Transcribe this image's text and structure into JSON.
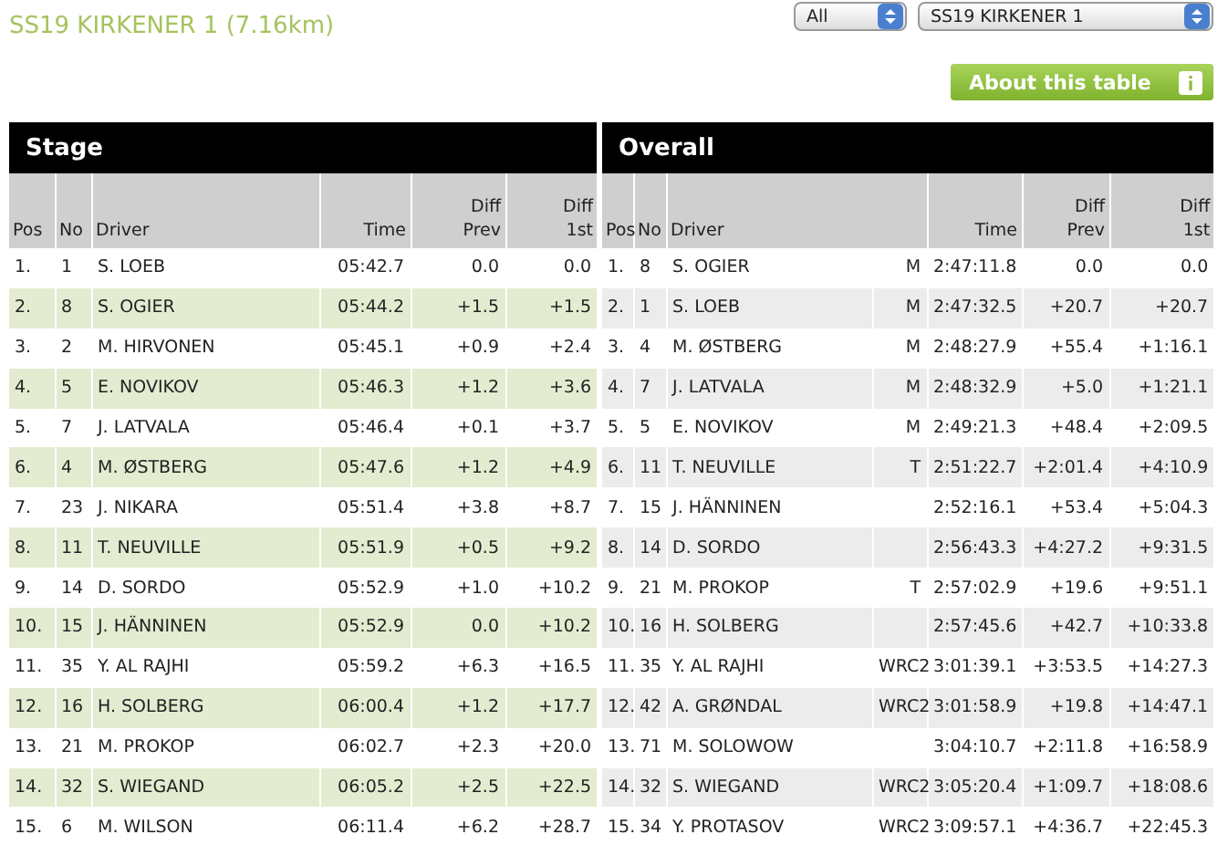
{
  "title": "SS19 KIRKENER 1 (7.16km)",
  "filters": [
    {
      "value": "All"
    },
    {
      "value": "SS19 KIRKENER 1"
    }
  ],
  "about_button": {
    "label": "About this table"
  },
  "stage": {
    "title": "Stage",
    "columns": [
      "Pos",
      "No",
      "Driver",
      "Time",
      "Diff Prev",
      "Diff 1st"
    ],
    "rows": [
      [
        "1.",
        "1",
        "S. LOEB",
        "05:42.7",
        "0.0",
        "0.0"
      ],
      [
        "2.",
        "8",
        "S. OGIER",
        "05:44.2",
        "+1.5",
        "+1.5"
      ],
      [
        "3.",
        "2",
        "M. HIRVONEN",
        "05:45.1",
        "+0.9",
        "+2.4"
      ],
      [
        "4.",
        "5",
        "E. NOVIKOV",
        "05:46.3",
        "+1.2",
        "+3.6"
      ],
      [
        "5.",
        "7",
        "J. LATVALA",
        "05:46.4",
        "+0.1",
        "+3.7"
      ],
      [
        "6.",
        "4",
        "M. ØSTBERG",
        "05:47.6",
        "+1.2",
        "+4.9"
      ],
      [
        "7.",
        "23",
        "J. NIKARA",
        "05:51.4",
        "+3.8",
        "+8.7"
      ],
      [
        "8.",
        "11",
        "T. NEUVILLE",
        "05:51.9",
        "+0.5",
        "+9.2"
      ],
      [
        "9.",
        "14",
        "D. SORDO",
        "05:52.9",
        "+1.0",
        "+10.2"
      ],
      [
        "10.",
        "15",
        "J. HÄNNINEN",
        "05:52.9",
        "0.0",
        "+10.2"
      ],
      [
        "11.",
        "35",
        "Y. AL RAJHI",
        "05:59.2",
        "+6.3",
        "+16.5"
      ],
      [
        "12.",
        "16",
        "H. SOLBERG",
        "06:00.4",
        "+1.2",
        "+17.7"
      ],
      [
        "13.",
        "21",
        "M. PROKOP",
        "06:02.7",
        "+2.3",
        "+20.0"
      ],
      [
        "14.",
        "32",
        "S. WIEGAND",
        "06:05.2",
        "+2.5",
        "+22.5"
      ],
      [
        "15.",
        "6",
        "M. WILSON",
        "06:11.4",
        "+6.2",
        "+28.7"
      ]
    ]
  },
  "overall": {
    "title": "Overall",
    "columns": [
      "Pos",
      "No",
      "Driver",
      "",
      "Time",
      "Diff Prev",
      "Diff 1st"
    ],
    "rows": [
      [
        "1.",
        "8",
        "S. OGIER",
        "M",
        "2:47:11.8",
        "0.0",
        "0.0"
      ],
      [
        "2.",
        "1",
        "S. LOEB",
        "M",
        "2:47:32.5",
        "+20.7",
        "+20.7"
      ],
      [
        "3.",
        "4",
        "M. ØSTBERG",
        "M",
        "2:48:27.9",
        "+55.4",
        "+1:16.1"
      ],
      [
        "4.",
        "7",
        "J. LATVALA",
        "M",
        "2:48:32.9",
        "+5.0",
        "+1:21.1"
      ],
      [
        "5.",
        "5",
        "E. NOVIKOV",
        "M",
        "2:49:21.3",
        "+48.4",
        "+2:09.5"
      ],
      [
        "6.",
        "11",
        "T. NEUVILLE",
        "T",
        "2:51:22.7",
        "+2:01.4",
        "+4:10.9"
      ],
      [
        "7.",
        "15",
        "J. HÄNNINEN",
        "",
        "2:52:16.1",
        "+53.4",
        "+5:04.3"
      ],
      [
        "8.",
        "14",
        "D. SORDO",
        "",
        "2:56:43.3",
        "+4:27.2",
        "+9:31.5"
      ],
      [
        "9.",
        "21",
        "M. PROKOP",
        "T",
        "2:57:02.9",
        "+19.6",
        "+9:51.1"
      ],
      [
        "10.",
        "16",
        "H. SOLBERG",
        "",
        "2:57:45.6",
        "+42.7",
        "+10:33.8"
      ],
      [
        "11.",
        "35",
        "Y. AL RAJHI",
        "WRC2",
        "3:01:39.1",
        "+3:53.5",
        "+14:27.3"
      ],
      [
        "12.",
        "42",
        "A. GRØNDAL",
        "WRC2",
        "3:01:58.9",
        "+19.8",
        "+14:47.1"
      ],
      [
        "13.",
        "71",
        "M. SOLOWOW",
        "",
        "3:04:10.7",
        "+2:11.8",
        "+16:58.9"
      ],
      [
        "14.",
        "32",
        "S. WIEGAND",
        "WRC2",
        "3:05:20.4",
        "+1:09.7",
        "+18:08.6"
      ],
      [
        "15.",
        "34",
        "Y. PROTASOV",
        "WRC2",
        "3:09:57.1",
        "+4:36.7",
        "+22:45.3"
      ]
    ]
  }
}
